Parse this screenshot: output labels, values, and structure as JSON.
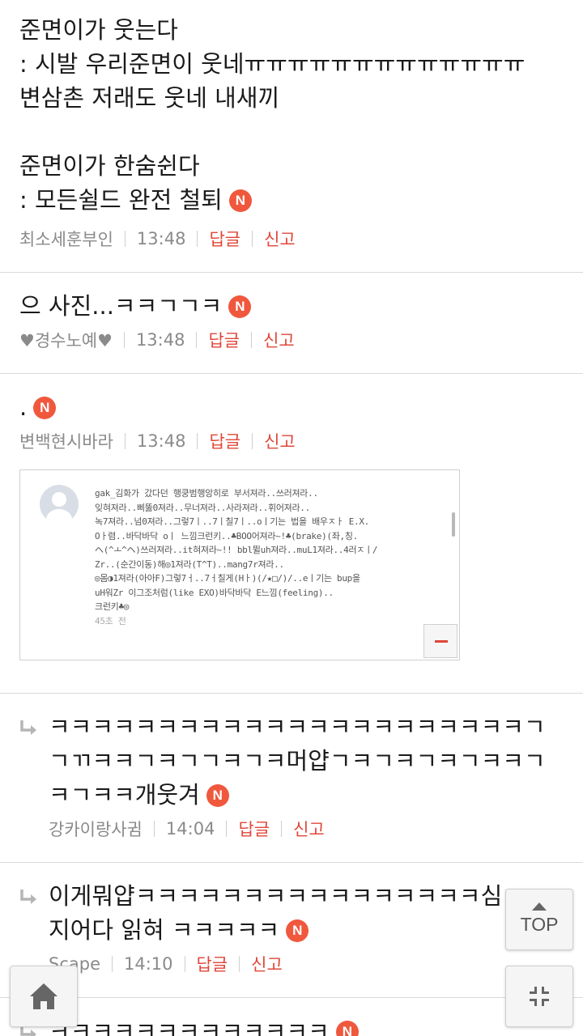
{
  "comments": [
    {
      "text": "준면이가 웃는다\n: 시발 우리준면이 웃네ㅠㅠㅠㅠㅠㅠㅠㅠㅠㅠㅠㅠㅠ\n변삼촌 저래도 웃네 내새끼\n\n준면이가 한숨쉰다\n: 모든쉴드 완전 철퇴",
      "badge": "N",
      "author": "최소세훈부인",
      "time": "13:48",
      "reply_label": "답글",
      "report_label": "신고"
    },
    {
      "text": "으 사진...ㅋㅋㄱㄱㅋ",
      "badge": "N",
      "author": "♥경수노예♥",
      "time": "13:48",
      "reply_label": "답글",
      "report_label": "신고"
    },
    {
      "text": ".",
      "badge": "N",
      "author": "변백현시바라",
      "time": "13:48",
      "reply_label": "답글",
      "report_label": "신고",
      "embed": {
        "lines": [
          "gak_김화가 갔다던 행쿵범행앙히로 부서져라..쓰러져라..",
          "잊혀져라..삐뚫0져라..무너져라..사라져라..휘어져라..",
          "녹7져라..넘0져라..그렇7ㅣ..7ㅣ칠7ㅣ..oㅣ기는 법을 배우ㅈㅏ E.X.",
          "Oㅏ렴..바닥바닥 oㅣ 느낌크런키..♣BOO어져라~!♣(brake)(좌,칭.",
          "ヘ(^ㅗ^ヘ)쓰러져라..it혀져라~!! bbl뛸uh져라..muL1져라..4러ㅈㅣ/",
          "Zr..(순간이동)해◎1져라(T^T)..mang7r져라..",
          "◎몸◑1져라(아아F)그렇7ㅓ..7ㅓ칠게(Hㅏ)(/★□/)/..eㅣ기는 bup을",
          "uH워Zr 이그조처럼(like EXO)바닥바닥 E느낌(feeling)..",
          "크런키♣◎"
        ],
        "timestamp": "45초 전"
      }
    },
    {
      "reply": true,
      "text": "ㅋㅋㅋㅋㅋㅋㅋㅋㅋㅋㅋㅋㅋㅋㅋㅋㅋㅋㅋㅋㅋㅋㄱㄱㄲㅋㅋㄱㅋㄱㄱㅋㄱㅋ머얍ㄱㅋㄱㅋㄱㅋㄱㅋㅋㄱㅋㄱㅋㅋ개웃겨",
      "badge": "N",
      "author": "강카이랑사귐",
      "time": "14:04",
      "reply_label": "답글",
      "report_label": "신고"
    },
    {
      "reply": true,
      "text": "이게뭐얍ㅋㅋㅋㅋㅋㅋㅋㅋㅋㅋㅋㅋㅋㅋㅋㅋ심지어다 읽혀 ㅋㅋㅋㅋㅋ",
      "badge": "N",
      "author": "Scape",
      "time": "14:10",
      "reply_label": "답글",
      "report_label": "신고"
    },
    {
      "reply": true,
      "text": "ㅋㅋㅋㅋㅋㅋㅋㅋㅋㅋㅋㅋㅋ",
      "badge": "N"
    }
  ],
  "floating": {
    "top_label": "TOP",
    "top_icon": "chevron-up-icon",
    "home_icon": "home-icon",
    "collapse_icon": "collapse-icon"
  },
  "colors": {
    "badge": "#f0583d",
    "action": "#e0473a",
    "meta": "#8a8a8a",
    "divider": "#d9d9d9"
  }
}
